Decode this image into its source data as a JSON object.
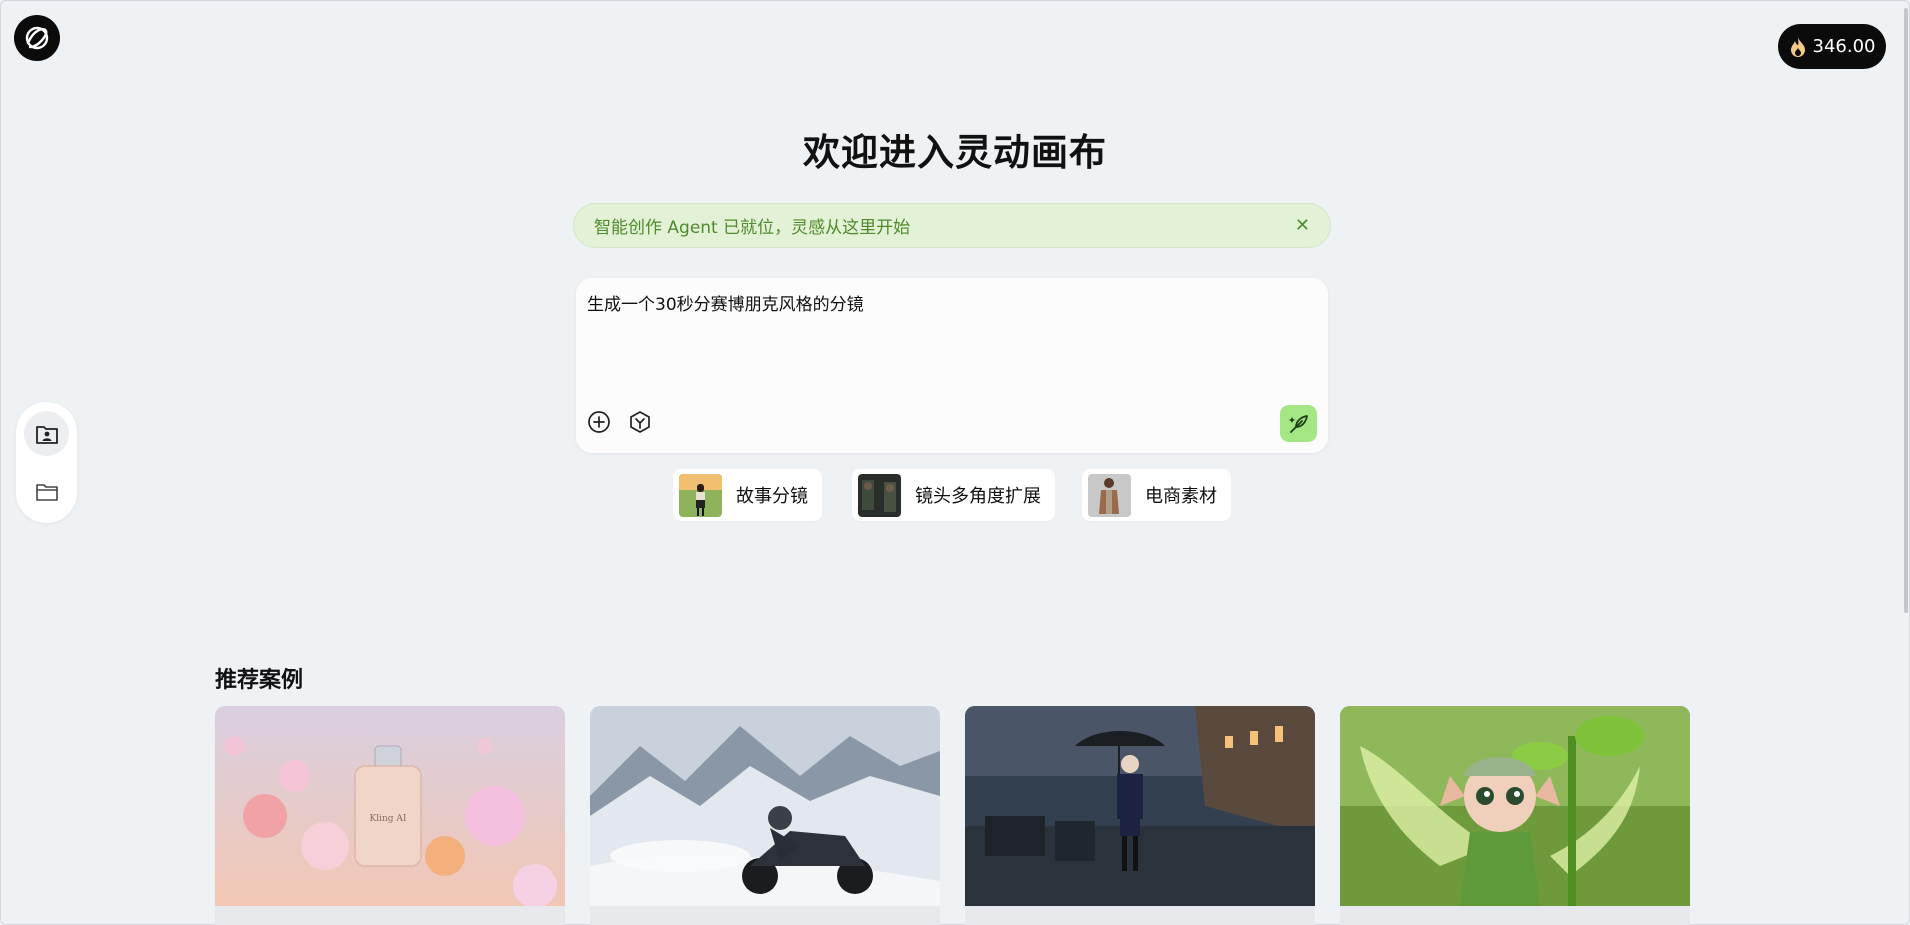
{
  "header": {
    "credits": "346.00"
  },
  "welcome": {
    "title": "欢迎进入灵动画布"
  },
  "notice": {
    "text": "智能创作 Agent 已就位，灵感从这里开始",
    "close": "✕"
  },
  "composer": {
    "prompt": "生成一个30秒分赛博朋克风格的分镜"
  },
  "chips": [
    {
      "label": "故事分镜"
    },
    {
      "label": "镜头多角度扩展"
    },
    {
      "label": "电商素材"
    }
  ],
  "recommended": {
    "title": "推荐案例"
  },
  "cards": [
    {
      "bottle_label": "Kling AI"
    }
  ],
  "colors": {
    "accent": "#a3e683",
    "notice_bg": "#e3f1d6",
    "notice_text": "#4f8b2c",
    "dark": "#0b0b0b"
  }
}
